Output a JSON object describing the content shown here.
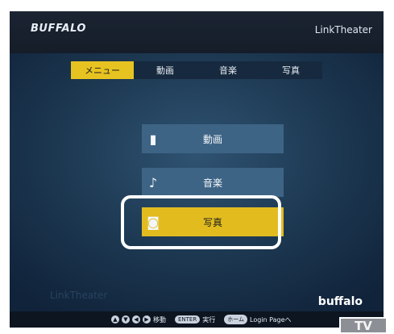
{
  "header": {
    "brand": "BUFFALO",
    "app_title": "LinkTheater"
  },
  "tabs": [
    {
      "label": "メニュー",
      "active": true
    },
    {
      "label": "動画",
      "active": false
    },
    {
      "label": "音楽",
      "active": false
    },
    {
      "label": "写真",
      "active": false
    }
  ],
  "menu": [
    {
      "label": "動画",
      "icon": "video-icon",
      "glyph": "▮"
    },
    {
      "label": "音楽",
      "icon": "music-note-icon",
      "glyph": "♪"
    },
    {
      "label": "写真",
      "icon": "camera-icon",
      "glyph": "◙",
      "selected": true
    }
  ],
  "footer": {
    "watermark": "LinkTheater",
    "brand": "buffalo",
    "nav_keys": [
      "▲",
      "▼",
      "◀",
      "▶"
    ],
    "move_label": "移動",
    "enter_key": "ENTER",
    "enter_label": "実行",
    "home_key": "ホーム",
    "home_label": "Login Pageへ"
  },
  "corner_badge": "TV",
  "colors": {
    "accent": "#e2bc1f",
    "button": "#3d6485",
    "background": "#1c3750"
  }
}
